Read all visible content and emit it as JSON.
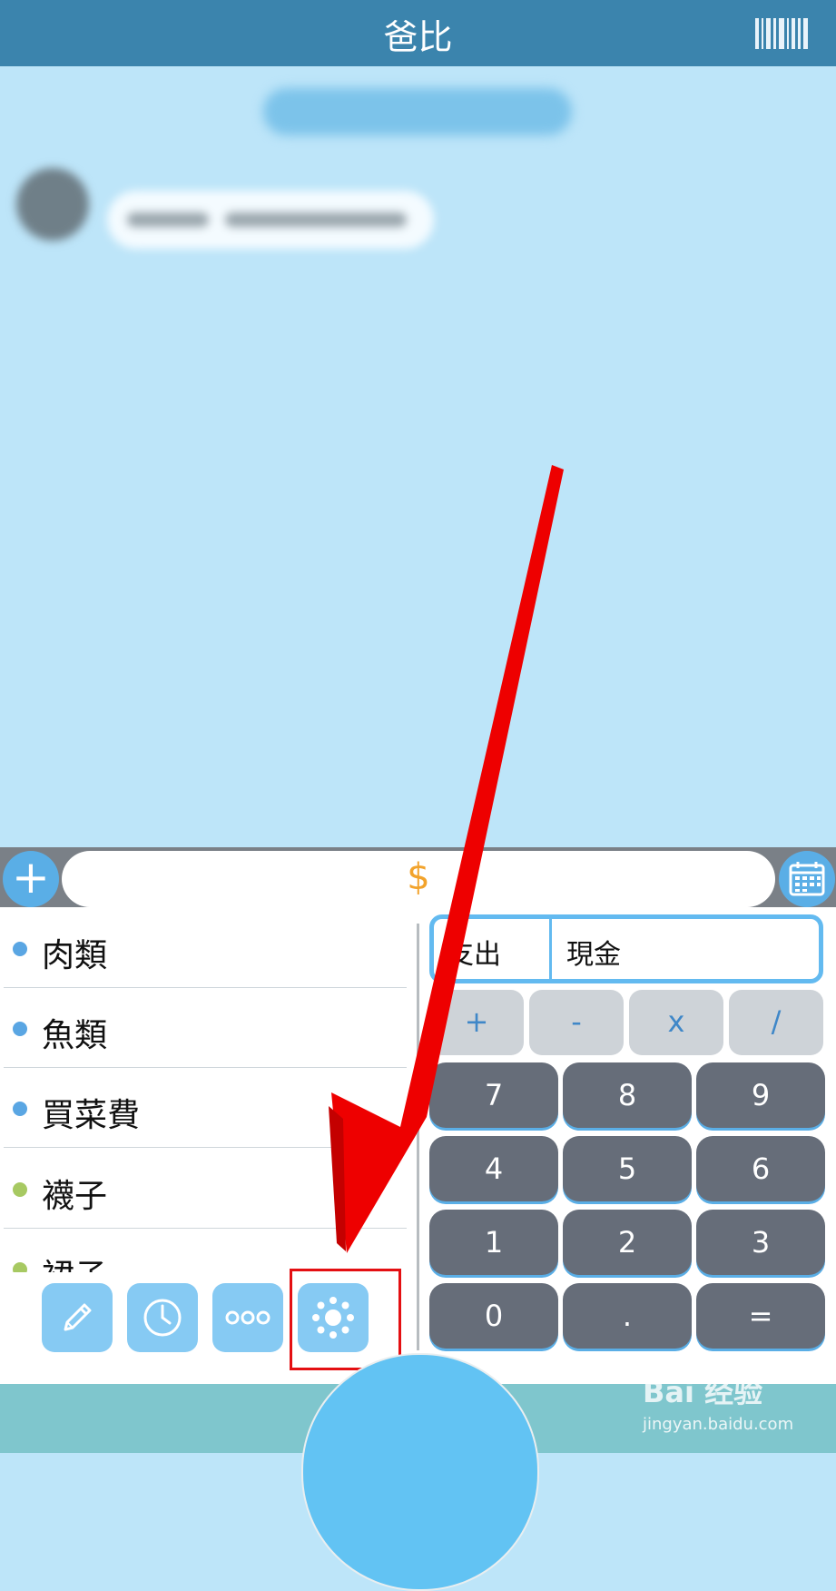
{
  "header": {
    "title": "爸比"
  },
  "entry": {
    "currency_symbol": "$"
  },
  "categories": [
    {
      "label": "肉類",
      "color": "#5aa6e3"
    },
    {
      "label": "魚類",
      "color": "#5aa6e3"
    },
    {
      "label": "買菜費",
      "color": "#5aa6e3"
    },
    {
      "label": "襪子",
      "color": "#a7c962"
    },
    {
      "label": "裙子",
      "color": "#a7c962"
    }
  ],
  "toolbar": [
    "pencil-icon",
    "clock-icon",
    "more-dots-icon",
    "theme-dots-icon"
  ],
  "transaction": {
    "type": "支出",
    "account": "現金"
  },
  "operators": [
    "+",
    "-",
    "x",
    "/"
  ],
  "keypad": [
    [
      "7",
      "8",
      "9"
    ],
    [
      "4",
      "5",
      "6"
    ],
    [
      "1",
      "2",
      "3"
    ],
    [
      "0",
      ".",
      "="
    ]
  ],
  "watermark": {
    "logo": "Bai  经验",
    "url": "jingyan.baidu.com"
  },
  "colors": {
    "header": "#3b84ad",
    "background": "#bde5f9",
    "accent": "#5aaee6",
    "annotation": "#e40f12"
  }
}
